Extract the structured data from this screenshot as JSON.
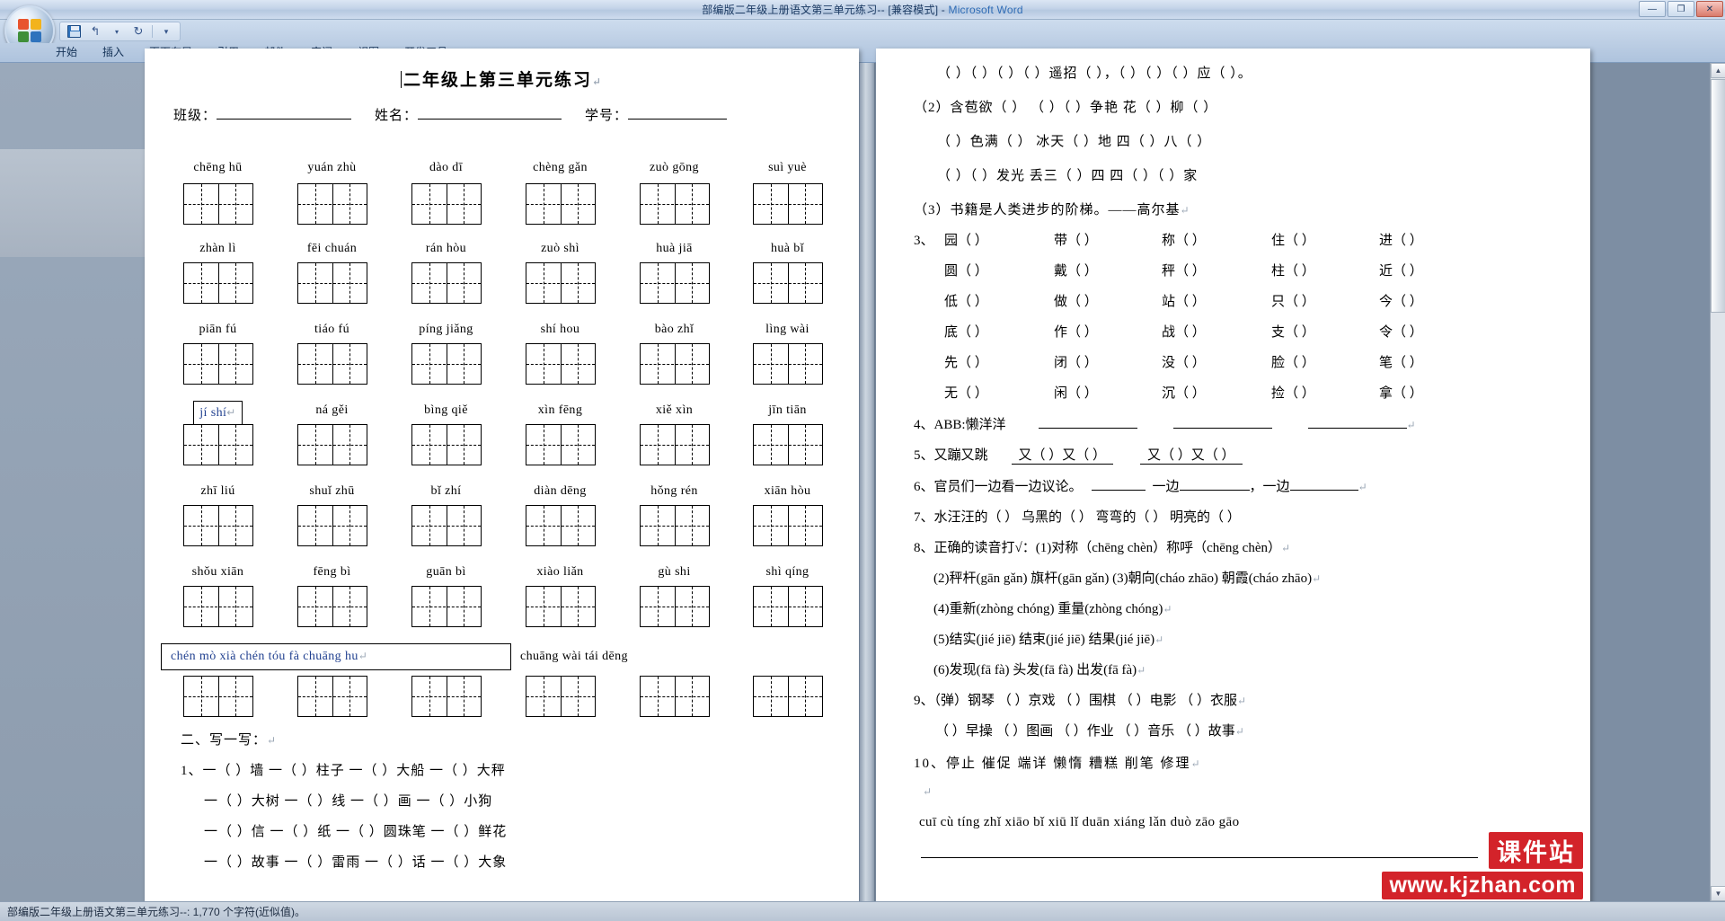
{
  "window": {
    "title_doc": "部编版二年级上册语文第三单元练习-- [兼容模式]",
    "title_sep": " - ",
    "title_app": "Microsoft Word",
    "minimize": "—",
    "maximize": "❐",
    "close": "✕"
  },
  "qat": {
    "save_name": "save-icon",
    "undo": "↰",
    "undo_dropdown": "▾",
    "redo": "↻",
    "more": "▾"
  },
  "ribbon": {
    "tabs": [
      {
        "label": "开始"
      },
      {
        "label": "插入"
      },
      {
        "label": "页面布局"
      },
      {
        "label": "引用"
      },
      {
        "label": "邮件"
      },
      {
        "label": "审阅"
      },
      {
        "label": "视图"
      },
      {
        "label": "开发工具"
      }
    ]
  },
  "statusbar": {
    "text": "部编版二年级上册语文第三单元练习--: 1,770 个字符(近似值)。"
  },
  "scrollbar": {
    "up_arrow": "▲",
    "down_arrow": "▼"
  },
  "document": {
    "title": "二年级上第三单元练习",
    "pilcrow": "↵",
    "header_fields": [
      {
        "label": "班级：",
        "line_width": 150
      },
      {
        "label": "姓名：",
        "line_width": 160
      },
      {
        "label": "学号：",
        "line_width": 110
      }
    ],
    "pinyin_rows": [
      {
        "position": "above",
        "items": [
          "chēng hū",
          "yuán zhù",
          "dào  dī",
          "chèng gǎn",
          "zuò gōng",
          "suì  yuè"
        ]
      },
      {
        "position": "below",
        "items": [
          "zhàn lì",
          "fēi chuán",
          "rán hòu",
          "zuò shì",
          "huà  jiā",
          "huà  bǐ"
        ]
      },
      {
        "position": "below",
        "items": [
          "piān fú",
          "tiáo  fú",
          "píng jiǎng",
          "shí hou",
          "bào zhǐ",
          "lìng wài"
        ]
      },
      {
        "position": "below",
        "items": [
          "jí  shí",
          "ná gěi",
          "bìng qiě",
          "xìn fēng",
          "xiě xìn",
          "jīn tiān"
        ]
      },
      {
        "position": "below",
        "items": [
          "zhī liú",
          "shuǐ zhū",
          "bǐ zhí",
          "diàn dēng",
          "hǒng rén",
          "xiān hòu"
        ]
      },
      {
        "position": "below",
        "items": [
          "shǒu xiān",
          "fēng bì",
          "guān bì",
          "xiào liǎn",
          "gù  shi",
          "shì qíng"
        ]
      },
      {
        "position": "below",
        "items": [
          "chén mò    xià  chén    tóu  fà    chuāng hu",
          "chuāng wài",
          "tái dēng"
        ]
      }
    ],
    "selected_cell_1": {
      "text": "jí  shí",
      "pilcrow": "↵"
    },
    "selected_row": {
      "text": "chén mò       xià  chén        tóu  fà        chuāng hu",
      "pilcrow": "↵"
    },
    "selected_row_tail": "chuāng wài  tái dēng",
    "section_two_heading": "二、写一写：",
    "section_two_lines": [
      "1、一（    ）墙    一（    ）柱子    一（    ）大船    一（    ）大秤",
      "一（    ）大树    一（    ）线    一（    ）画    一（    ）小狗",
      "一（    ）信    一（    ）纸    一（    ）圆珠笔    一（    ）鲜花",
      "一（    ）故事    一（    ）雷雨    一（    ）话    一（    ）大象"
    ],
    "right_lines": [
      "（    ）（    ）（    ）（    ）遥招（     ），（    ）（    ）（    ）应（    ）。",
      "（2）含苞欲（    ）        （    ）（    ）争艳    花（    ）柳（    ）",
      "（    ）色满（    ）      冰天（    ）地        四（    ）八（    ）",
      "（    ）（    ）发光      丢三（    ）四        四（    ）（    ）家",
      "（3）书籍是人类进步的阶梯。——高尔基"
    ],
    "char_table_heading": "3、",
    "char_table": [
      [
        "园（     ）",
        "带（     ）",
        "称（     ）",
        "住（     ）",
        "进（     ）"
      ],
      [
        "圆（     ）",
        "戴（     ）",
        "秤（     ）",
        "柱（     ）",
        "近（     ）"
      ],
      [
        "低（     ）",
        "做（     ）",
        "站（     ）",
        "只（     ）",
        "今（     ）"
      ],
      [
        "底（     ）",
        "作（     ）",
        "战（     ）",
        "支（     ）",
        "令（     ）"
      ],
      [
        "先（     ）",
        "闭（     ）",
        "没（     ）",
        "脸（     ）",
        "笔（     ）"
      ],
      [
        "无（     ）",
        "闲（     ）",
        "沉（     ）",
        "捡（     ）",
        "拿（     ）"
      ]
    ],
    "numbered_items": [
      {
        "num": "4、",
        "text": "ABB:懒洋洋",
        "blanks": 3
      },
      {
        "num": "5、",
        "text": "又蹦又跳",
        "underlined": "又（    ）又（    ）",
        "underlined2": "又（    ）又（    ）"
      },
      {
        "num": "6、",
        "text": "官员们一边看一边议论。",
        "tail": "一边",
        "tail2": "，一边"
      },
      {
        "num": "7、",
        "text": "水汪汪的（     ）  乌黑的（     ）  弯弯的（     ）  明亮的（     ）"
      },
      {
        "num": "8、",
        "text": "正确的读音打√：(1)对称（chēng chèn）称呼（chēng chèn）"
      },
      {
        "num": "",
        "text": "(2)秤杆(gān gǎn) 旗杆(gān gǎn) (3)朝向(cháo zhāo) 朝霞(cháo zhāo)"
      },
      {
        "num": "",
        "text": "(4)重新(zhòng chóng)   重量(zhòng chóng)"
      },
      {
        "num": "",
        "text": "(5)结实(jié jiē) 结束(jié jiē) 结果(jié jiē)"
      },
      {
        "num": "",
        "text": "(6)发现(fā fà)  头发(fā fà) 出发(fā fà)"
      },
      {
        "num": "9、",
        "text": "（弹）钢琴  （     ）京戏  （     ）围棋  （     ）电影  （     ）衣服"
      },
      {
        "num": "",
        "text": "（     ）早操  （     ）图画  （     ）作业  （     ）音乐  （     ）故事"
      },
      {
        "num": "10、",
        "text": "停止    催促    端详    懒惰    糟糕    削笔    修理"
      }
    ],
    "bottom_pinyin": "cuī cù    tíng zhǐ    xiāo bǐ    xiū lǐ    duān xiáng    lǎn duò    zāo gāo"
  },
  "watermark": {
    "line1": "课件站",
    "line2": "www.kjzhan.com"
  },
  "colors": {
    "watermark_red": "#d3232a",
    "title_blue": "#2f6cb5",
    "selection_blue": "#1f3f8f"
  }
}
